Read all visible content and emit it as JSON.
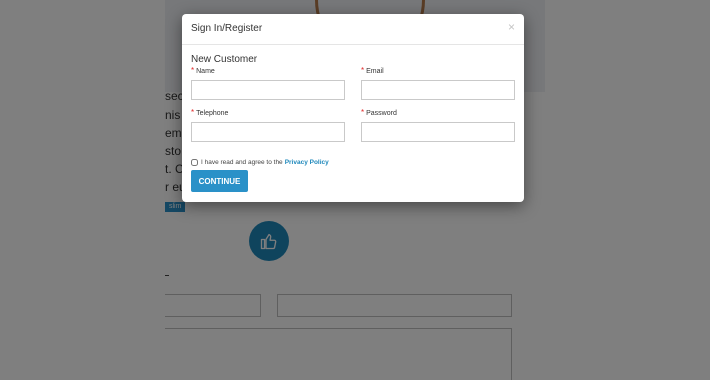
{
  "background": {
    "text_fragments": [
      "sect",
      "nis",
      "em.",
      "sto,",
      "t. C",
      "r eu"
    ],
    "tag_label": "slim",
    "like_icon": "thumbs-up-icon"
  },
  "modal": {
    "title": "Sign In/Register",
    "close_label": "×",
    "section_title": "New Customer",
    "required_marker": "*",
    "fields": {
      "name": {
        "label": "Name",
        "value": "",
        "placeholder": ""
      },
      "email": {
        "label": "Email",
        "value": "",
        "placeholder": ""
      },
      "telephone": {
        "label": "Telephone",
        "value": "",
        "placeholder": ""
      },
      "password": {
        "label": "Password",
        "value": "",
        "placeholder": ""
      }
    },
    "agree_text": "I have read and agree to the",
    "agree_link": "Privacy Policy",
    "continue_label": "CONTINUE"
  },
  "colors": {
    "accent": "#2a91c8",
    "required": "#e02828",
    "overlay": "rgba(0,0,0,0.5)"
  }
}
